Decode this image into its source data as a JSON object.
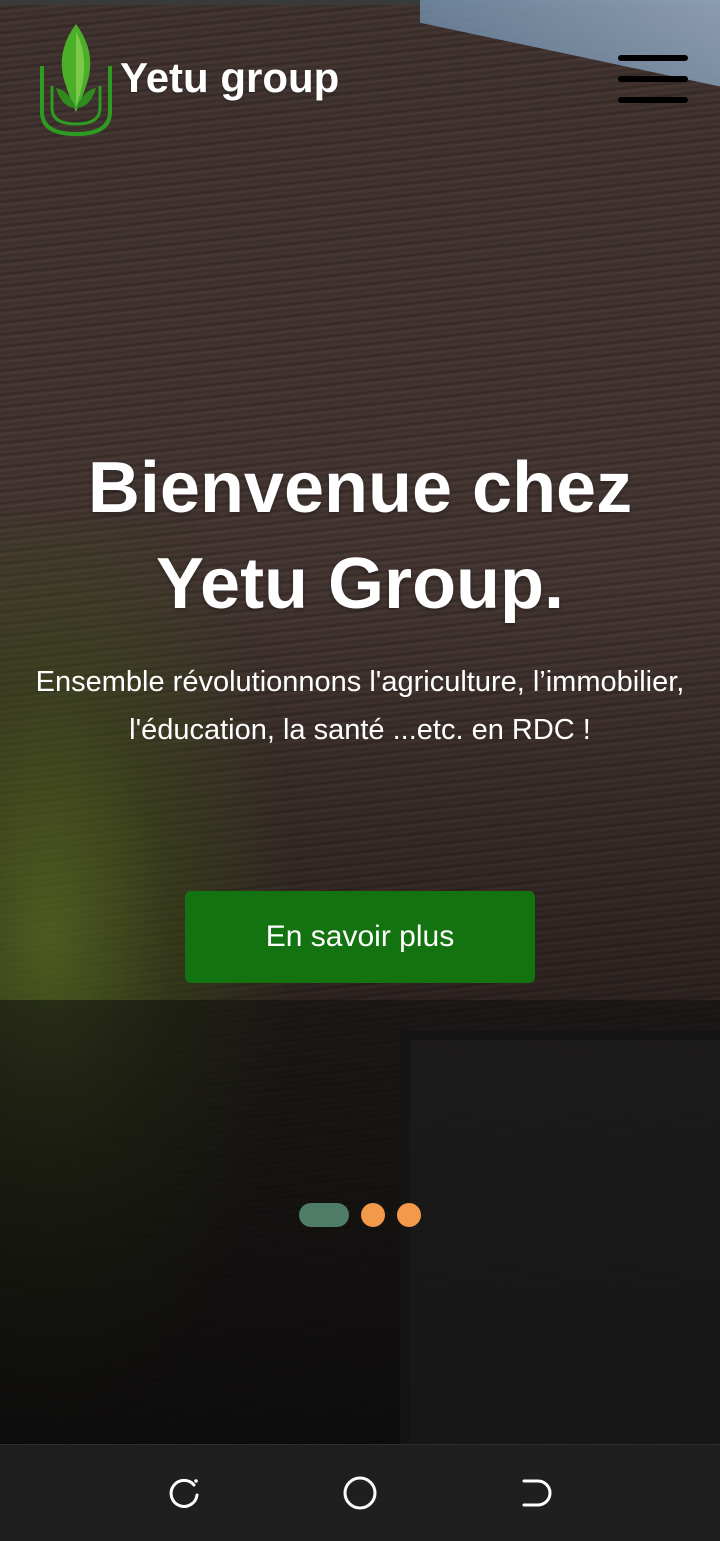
{
  "header": {
    "brand": "Yetu group"
  },
  "hero": {
    "headline": "Bienvenue chez Yetu Group.",
    "subtext": "Ensemble révolutionnons l'agriculture, l’immobilier, l'éducation, la santé ...etc. en RDC !",
    "cta_label": "En savoir plus"
  },
  "carousel": {
    "slide_count": 3,
    "active_index": 0
  },
  "colors": {
    "accent_green": "#127310",
    "dot_active": "#4f7c66",
    "dot_inactive": "#f2994a"
  },
  "icons": {
    "menu": "hamburger-menu-icon",
    "logo": "leaf-shield-logo",
    "nav_recents": "recents-icon",
    "nav_home": "home-icon",
    "nav_back": "back-icon"
  }
}
